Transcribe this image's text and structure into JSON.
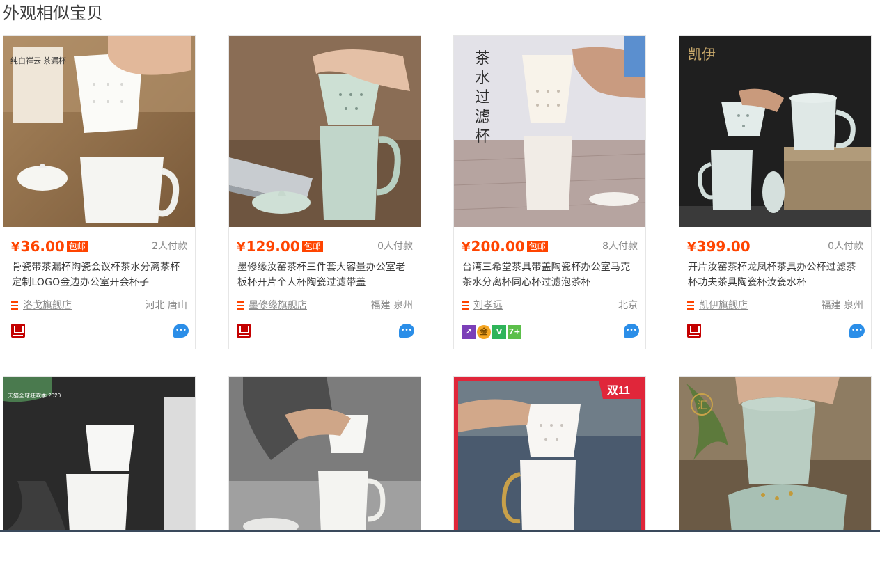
{
  "section": {
    "title": "外观相似宝贝"
  },
  "products": [
    {
      "price": "36.00",
      "yen": "¥",
      "free_shipping": "包邮",
      "buyers": "2人付款",
      "title": "骨瓷带茶漏杯陶瓷会议杯茶水分离茶杯定制LOGO金边办公室开会杯子",
      "shop": "洛戈旗舰店",
      "location": "河北 唐山",
      "image_text": "纯白祥云 茶漏杯",
      "badge_type": "tmall",
      "chat_icon": "wangwang-icon"
    },
    {
      "price": "129.00",
      "yen": "¥",
      "free_shipping": "包邮",
      "buyers": "0人付款",
      "title": "墨修缘汝窑茶杯三件套大容量办公室老板杯开片个人杯陶瓷过滤带盖",
      "shop": "墨修缘旗舰店",
      "location": "福建 泉州",
      "image_text": "",
      "badge_type": "tmall",
      "chat_icon": "wangwang-icon"
    },
    {
      "price": "200.00",
      "yen": "¥",
      "free_shipping": "包邮",
      "buyers": "8人付款",
      "title": "台湾三希堂茶具带盖陶瓷杯办公室马克茶水分离杯同心杯过滤泡茶杯",
      "shop": "刘孝远",
      "location": "北京",
      "image_text": "茶水过滤杯",
      "badge_type": "seller",
      "chat_icon": "wangwang-icon",
      "mini_badges": [
        "↗",
        "金",
        "V",
        "7+"
      ]
    },
    {
      "price": "399.00",
      "yen": "¥",
      "free_shipping": "",
      "buyers": "0人付款",
      "title": "开片汝窑茶杯龙凤杯茶具办公杯过滤茶杯功夫茶具陶瓷杯汝瓷水杯",
      "shop": "凯伊旗舰店",
      "location": "福建 泉州",
      "image_text": "凯伊",
      "badge_type": "tmall",
      "chat_icon": "wangwang-icon"
    }
  ],
  "second_row": [
    {
      "image_text": "天猫全球狂欢季 2020"
    },
    {
      "image_text": ""
    },
    {
      "image_text": "双11"
    },
    {
      "image_text": "汇"
    }
  ],
  "colors": {
    "price": "#ff4400",
    "tmall_red": "#c40000",
    "chat_blue": "#2b8ee8"
  }
}
